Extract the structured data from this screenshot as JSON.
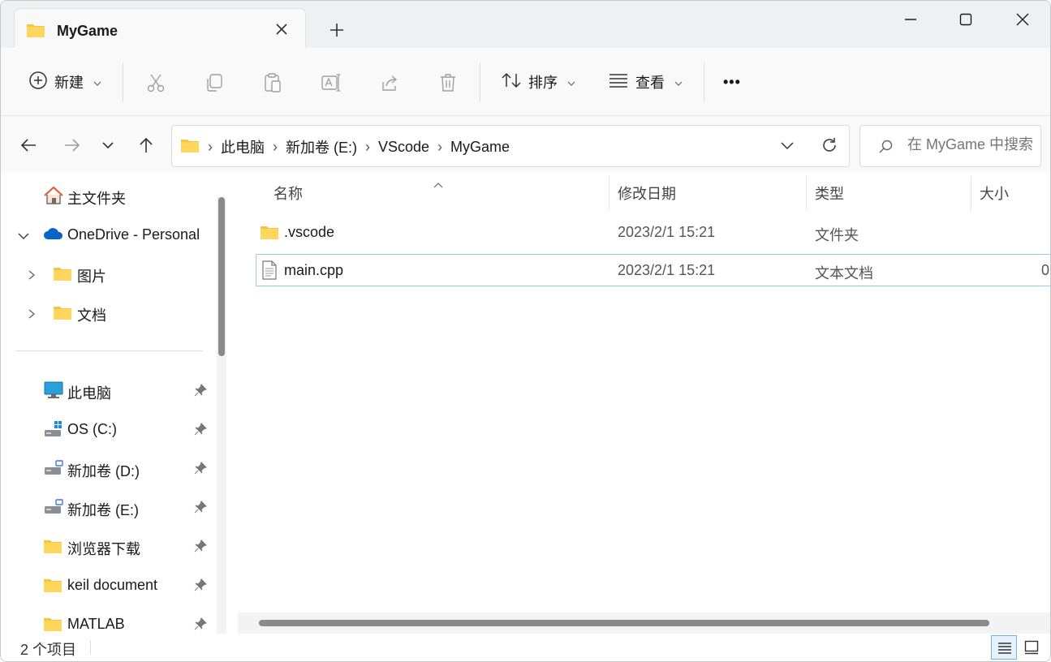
{
  "window": {
    "tab_title": "MyGame",
    "new_tab_symbol": "+",
    "controls": [
      "minimize",
      "maximize",
      "close"
    ]
  },
  "toolbar": {
    "new_label": "新建",
    "sort_label": "排序",
    "view_label": "查看",
    "more_label": "•••",
    "icons": [
      "cut-icon",
      "copy-icon",
      "paste-icon",
      "rename-icon",
      "share-icon",
      "delete-icon"
    ]
  },
  "address": {
    "crumbs": [
      "此电脑",
      "新加卷 (E:)",
      "VScode",
      "MyGame"
    ],
    "separator": "›"
  },
  "search": {
    "placeholder": "在 MyGame 中搜索"
  },
  "nav": {
    "home": "主文件夹",
    "onedrive": "OneDrive - Personal",
    "onedrive_children": [
      "图片",
      "文档"
    ],
    "pinned": [
      {
        "label": "此电脑",
        "icon": "computer-icon"
      },
      {
        "label": "OS (C:)",
        "icon": "drive-icon"
      },
      {
        "label": "新加卷 (D:)",
        "icon": "drive-icon"
      },
      {
        "label": "新加卷 (E:)",
        "icon": "drive-icon"
      },
      {
        "label": "浏览器下载",
        "icon": "folder-icon"
      },
      {
        "label": "keil document",
        "icon": "folder-icon"
      },
      {
        "label": "MATLAB",
        "icon": "folder-icon"
      }
    ]
  },
  "columns": {
    "name": "名称",
    "modified": "修改日期",
    "type": "类型",
    "size": "大小"
  },
  "files": [
    {
      "name": ".vscode",
      "modified": "2023/2/1 15:21",
      "type": "文件夹",
      "size": "",
      "icon": "folder-icon"
    },
    {
      "name": "main.cpp",
      "modified": "2023/2/1 15:21",
      "type": "文本文档",
      "size": "0",
      "icon": "text-file-icon",
      "selected": true
    }
  ],
  "status": {
    "item_count": "2 个项目"
  },
  "colors": {
    "folder": "#f4c542",
    "accent": "#0067c0",
    "selection_border": "#99c9ef"
  }
}
